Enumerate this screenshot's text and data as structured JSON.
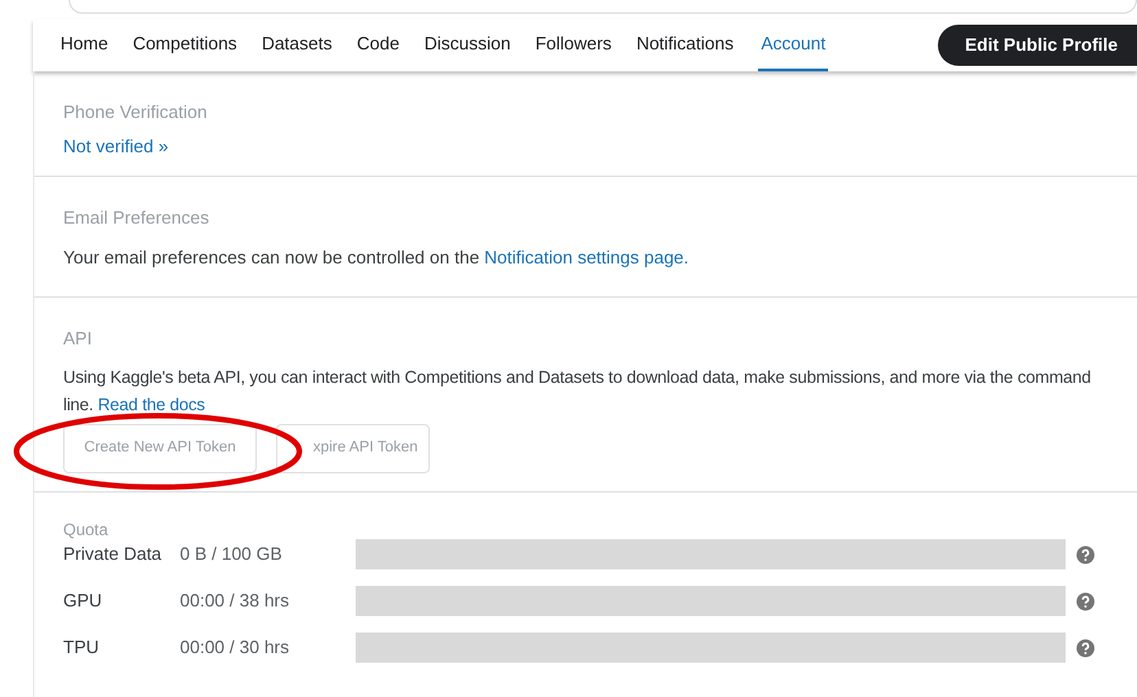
{
  "nav": {
    "tabs": [
      {
        "label": "Home",
        "selected": false
      },
      {
        "label": "Competitions",
        "selected": false
      },
      {
        "label": "Datasets",
        "selected": false
      },
      {
        "label": "Code",
        "selected": false
      },
      {
        "label": "Discussion",
        "selected": false
      },
      {
        "label": "Followers",
        "selected": false
      },
      {
        "label": "Notifications",
        "selected": false
      },
      {
        "label": "Account",
        "selected": true
      }
    ],
    "button": "Edit Public Profile"
  },
  "phone": {
    "heading": "Phone Verification",
    "link": "Not verified »"
  },
  "email": {
    "heading": "Email Preferences",
    "text": "Your email preferences can now be controlled on the ",
    "link": "Notification settings page."
  },
  "api": {
    "heading": "API",
    "text": "Using Kaggle's beta API, you can interact with Competitions and Datasets to download data, make submissions, and more via the command line. ",
    "link": "Read the docs",
    "buttons": [
      "Create New API Token",
      "xpire API Token"
    ]
  },
  "quota": {
    "heading": "Quota",
    "rows": [
      {
        "label": "Private Data",
        "value": "0 B / 100 GB",
        "level": 0
      },
      {
        "label": "GPU",
        "value": "00:00 / 38 hrs",
        "level": 0
      },
      {
        "label": "TPU",
        "value": "00:00 / 30 hrs",
        "level": 0
      }
    ]
  }
}
